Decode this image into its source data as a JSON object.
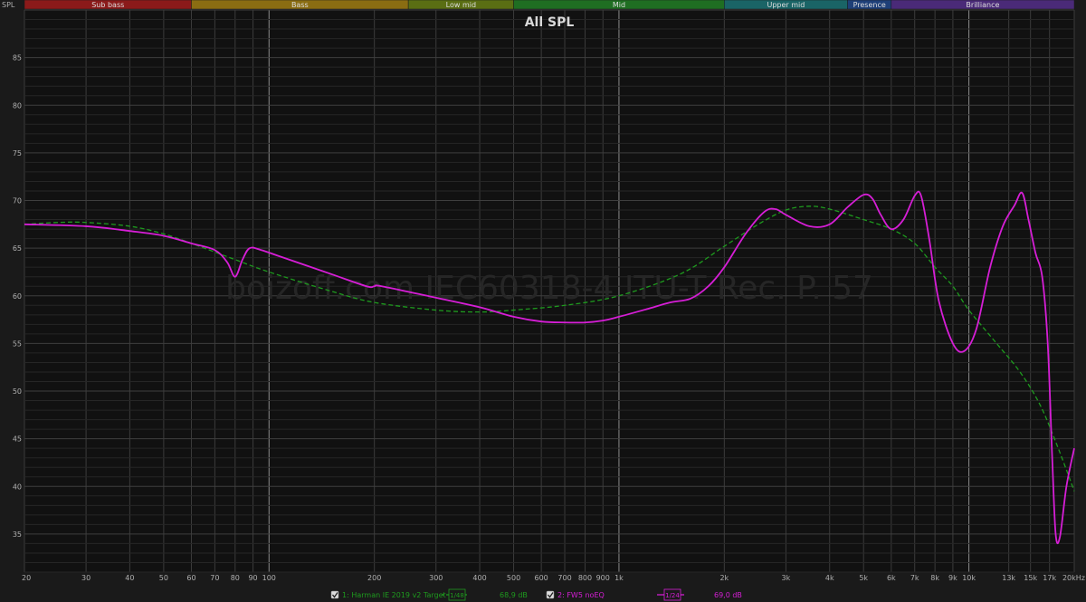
{
  "chart_data": {
    "type": "line",
    "title": "All SPL",
    "ylabel": "SPL",
    "watermark": "boizoff.com IEC60318-4 ITU-T Rec. P. 57",
    "xscale": "log",
    "xlim": [
      20,
      20000
    ],
    "ylim": [
      31,
      90
    ],
    "grid": true,
    "bands": [
      {
        "name": "Sub bass",
        "from": 20,
        "to": 60,
        "color": "#8b1a1a"
      },
      {
        "name": "Bass",
        "from": 60,
        "to": 250,
        "color": "#8a6d12"
      },
      {
        "name": "Low mid",
        "from": 250,
        "to": 500,
        "color": "#5a6e13"
      },
      {
        "name": "Mid",
        "from": 500,
        "to": 2000,
        "color": "#1f6e22"
      },
      {
        "name": "Upper mid",
        "from": 2000,
        "to": 4500,
        "color": "#1a6466"
      },
      {
        "name": "Presence",
        "from": 4500,
        "to": 6000,
        "color": "#1e3f78"
      },
      {
        "name": "Brilliance",
        "from": 6000,
        "to": 20000,
        "color": "#4a2a78"
      }
    ],
    "x_ticks": [
      {
        "v": 20,
        "label": "20"
      },
      {
        "v": 30,
        "label": "30"
      },
      {
        "v": 40,
        "label": "40"
      },
      {
        "v": 50,
        "label": "50"
      },
      {
        "v": 60,
        "label": "60"
      },
      {
        "v": 70,
        "label": "70"
      },
      {
        "v": 80,
        "label": "80"
      },
      {
        "v": 90,
        "label": "90"
      },
      {
        "v": 100,
        "label": "100"
      },
      {
        "v": 200,
        "label": "200"
      },
      {
        "v": 300,
        "label": "300"
      },
      {
        "v": 400,
        "label": "400"
      },
      {
        "v": 500,
        "label": "500"
      },
      {
        "v": 600,
        "label": "600"
      },
      {
        "v": 700,
        "label": "700"
      },
      {
        "v": 800,
        "label": "800"
      },
      {
        "v": 900,
        "label": "900"
      },
      {
        "v": 1000,
        "label": "1k"
      },
      {
        "v": 2000,
        "label": "2k"
      },
      {
        "v": 3000,
        "label": "3k"
      },
      {
        "v": 4000,
        "label": "4k"
      },
      {
        "v": 5000,
        "label": "5k"
      },
      {
        "v": 6000,
        "label": "6k"
      },
      {
        "v": 7000,
        "label": "7k"
      },
      {
        "v": 8000,
        "label": "8k"
      },
      {
        "v": 9000,
        "label": "9k"
      },
      {
        "v": 10000,
        "label": "10k"
      },
      {
        "v": 13000,
        "label": "13k"
      },
      {
        "v": 15000,
        "label": "15k"
      },
      {
        "v": 17000,
        "label": "17k"
      },
      {
        "v": 20000,
        "label": "20kHz"
      }
    ],
    "y_ticks": [
      35,
      40,
      45,
      50,
      55,
      60,
      65,
      70,
      75,
      80,
      85
    ],
    "series": [
      {
        "name": "1: Harman IE 2019 v2 Target",
        "color": "#1e9a1e",
        "dashed": true,
        "smoothing": "1/48",
        "level": "68,9 dB",
        "x": [
          20,
          25,
          30,
          40,
          50,
          60,
          80,
          100,
          150,
          200,
          300,
          400,
          500,
          700,
          1000,
          1500,
          2000,
          2500,
          3000,
          3500,
          4000,
          5000,
          6000,
          7000,
          8000,
          9000,
          10000,
          12000,
          14000,
          16000,
          18000,
          20000
        ],
        "y": [
          67.5,
          67.7,
          67.7,
          67.3,
          66.5,
          65.5,
          63.8,
          62.5,
          60.5,
          59.3,
          58.5,
          58.3,
          58.5,
          59.0,
          60.0,
          62.3,
          65.2,
          67.5,
          69.0,
          69.4,
          69.1,
          68.0,
          67.0,
          65.5,
          63.0,
          61.0,
          58.5,
          55.0,
          52.0,
          48.5,
          44.0,
          39.5
        ]
      },
      {
        "name": "2: FW5 noEQ",
        "color": "#d61ed6",
        "dashed": false,
        "smoothing": "1/24",
        "level": "69,0 dB",
        "x": [
          20,
          30,
          40,
          50,
          60,
          70,
          76,
          80,
          84,
          88,
          95,
          110,
          150,
          190,
          200,
          210,
          300,
          400,
          500,
          600,
          700,
          800,
          900,
          1000,
          1200,
          1400,
          1600,
          1800,
          2000,
          2300,
          2600,
          2800,
          3000,
          3500,
          4000,
          4500,
          5000,
          5300,
          5600,
          6000,
          6500,
          7000,
          7300,
          7700,
          8200,
          9000,
          9700,
          10500,
          11500,
          12500,
          13500,
          14200,
          14800,
          15500,
          16200,
          16800,
          17300,
          17700,
          18200,
          19000,
          20000
        ],
        "y": [
          67.5,
          67.3,
          66.8,
          66.3,
          65.5,
          64.8,
          63.5,
          62.0,
          63.8,
          65.0,
          64.8,
          64.0,
          62.3,
          61.0,
          61.0,
          61.0,
          59.8,
          58.8,
          57.8,
          57.3,
          57.2,
          57.2,
          57.4,
          57.8,
          58.6,
          59.3,
          59.7,
          61.0,
          63.0,
          66.5,
          68.8,
          69.1,
          68.5,
          67.3,
          67.5,
          69.3,
          70.6,
          70.2,
          68.5,
          67.0,
          68.0,
          70.5,
          70.5,
          66.0,
          59.5,
          55.0,
          54.2,
          56.5,
          63.0,
          67.3,
          69.5,
          70.8,
          68.0,
          64.5,
          62.0,
          55.0,
          43.0,
          35.0,
          34.7,
          40.0,
          44.0
        ]
      }
    ]
  }
}
